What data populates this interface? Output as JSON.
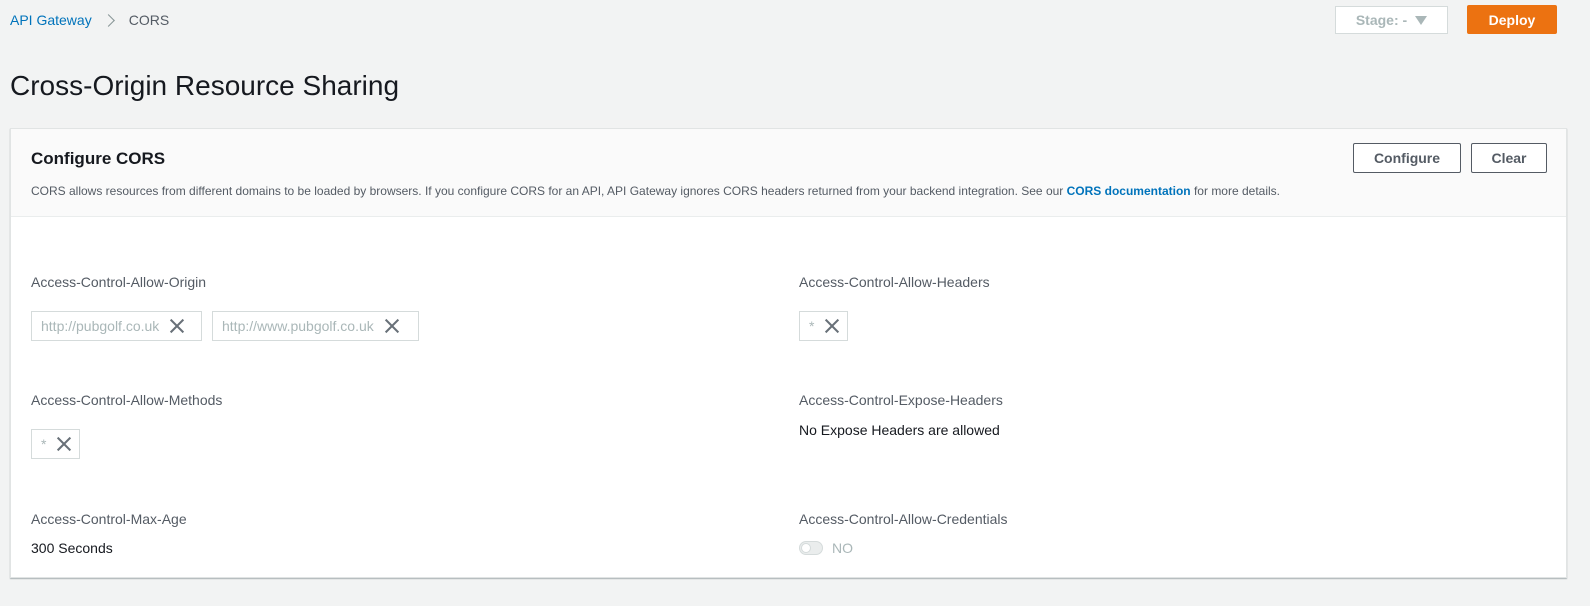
{
  "breadcrumb": {
    "root": "API Gateway",
    "current": "CORS"
  },
  "toolbar": {
    "stage_label": "Stage: -",
    "deploy_label": "Deploy"
  },
  "page": {
    "title": "Cross-Origin Resource Sharing"
  },
  "panel": {
    "title": "Configure CORS",
    "desc_before": "CORS allows resources from different domains to be loaded by browsers. If you configure CORS for an API, API Gateway ignores CORS headers returned from your backend integration. See our ",
    "desc_link": "CORS documentation",
    "desc_after": " for more details.",
    "configure_label": "Configure",
    "clear_label": "Clear"
  },
  "fields": {
    "allow_origin": {
      "label": "Access-Control-Allow-Origin",
      "tokens": [
        "http://pubgolf.co.uk",
        "http://www.pubgolf.co.uk"
      ]
    },
    "allow_headers": {
      "label": "Access-Control-Allow-Headers",
      "tokens": [
        "*"
      ]
    },
    "allow_methods": {
      "label": "Access-Control-Allow-Methods",
      "tokens": [
        "*"
      ]
    },
    "expose_headers": {
      "label": "Access-Control-Expose-Headers",
      "value": "No Expose Headers are allowed"
    },
    "max_age": {
      "label": "Access-Control-Max-Age",
      "value": "300 Seconds"
    },
    "allow_credentials": {
      "label": "Access-Control-Allow-Credentials",
      "toggle_label": "NO",
      "enabled": false
    }
  },
  "colors": {
    "accent": "#ec7211",
    "link": "#0073bb",
    "background": "#f2f3f3"
  },
  "icons": {
    "breadcrumb_separator": "chevron-right-icon",
    "stage_caret": "caret-down-icon",
    "token_remove": "close-icon"
  }
}
